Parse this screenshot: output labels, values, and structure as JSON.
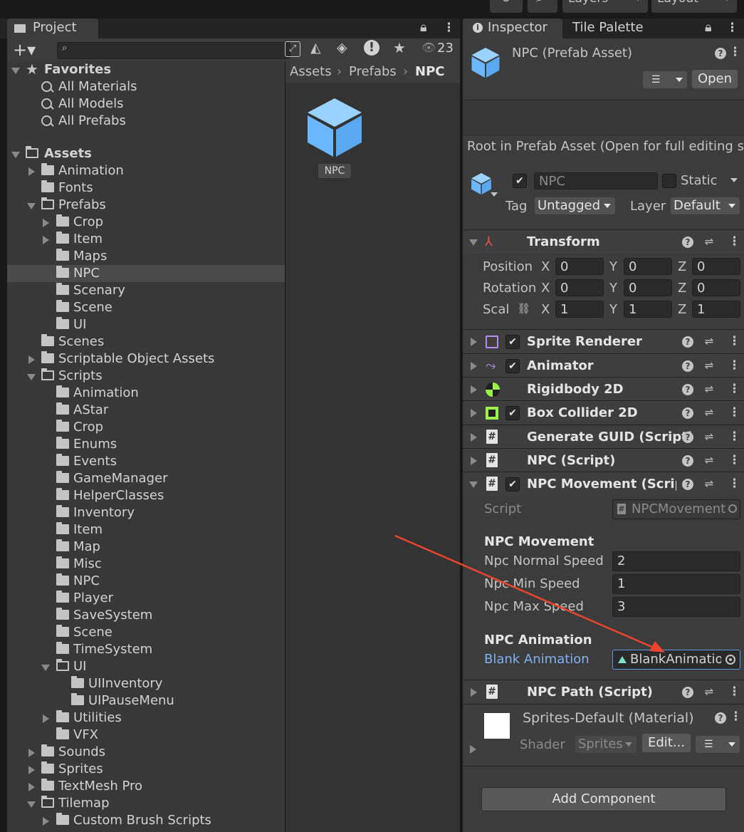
{
  "toolbar": {
    "layers_label": "Layers",
    "layout_label": "Layout"
  },
  "project": {
    "tab_label": "Project",
    "hidden_count": "23",
    "breadcrumb": [
      "Assets",
      "Prefabs",
      "NPC"
    ],
    "asset_label": "NPC",
    "favorites": {
      "label": "Favorites",
      "items": [
        "All Materials",
        "All Models",
        "All Prefabs"
      ]
    },
    "tree": [
      "Assets",
      "Animation",
      "Fonts",
      "Prefabs",
      "Crop",
      "Item",
      "Maps",
      "NPC",
      "Scenary",
      "Scene",
      "UI",
      "Scenes",
      "Scriptable Object Assets",
      "Scripts",
      "Animation",
      "AStar",
      "Crop",
      "Enums",
      "Events",
      "GameManager",
      "HelperClasses",
      "Inventory",
      "Item",
      "Map",
      "Misc",
      "NPC",
      "Player",
      "SaveSystem",
      "Scene",
      "TimeSystem",
      "UI",
      "UIInventory",
      "UIPauseMenu",
      "Utilities",
      "VFX",
      "Sounds",
      "Sprites",
      "TextMesh Pro",
      "Tilemap",
      "Custom Brush Scripts"
    ]
  },
  "inspector": {
    "tab_label": "Inspector",
    "tab2_label": "Tile Palette",
    "title": "NPC (Prefab Asset)",
    "open_label": "Open",
    "root_notice": "Root in Prefab Asset (Open for full editing su",
    "name_value": "NPC",
    "static_label": "Static",
    "tag_label": "Tag",
    "tag_value": "Untagged",
    "layer_label": "Layer",
    "layer_value": "Default",
    "transform": {
      "label": "Transform",
      "position_label": "Position",
      "rotation_label": "Rotation",
      "scale_label": "Scal",
      "position": [
        "0",
        "0",
        "0"
      ],
      "rotation": [
        "0",
        "0",
        "0"
      ],
      "scale": [
        "1",
        "1",
        "1"
      ],
      "axes": [
        "X",
        "Y",
        "Z"
      ]
    },
    "components": [
      "Sprite Renderer",
      "Animator",
      "Rigidbody 2D",
      "Box Collider 2D",
      "Generate GUID (Script)",
      "NPC (Script)",
      "NPC Movement (Script",
      "NPC Path (Script)"
    ],
    "movement": {
      "script_label": "Script",
      "script_value": "NPCMovement",
      "section1": "NPC Movement",
      "normal_label": "Npc Normal Speed",
      "normal_value": "2",
      "min_label": "Npc Min Speed",
      "min_value": "1",
      "max_label": "Npc Max Speed",
      "max_value": "3",
      "section2": "NPC Animation",
      "blank_label": "Blank Animation",
      "blank_value": "BlankAnimation"
    },
    "material": {
      "title": "Sprites-Default (Material)",
      "shader_label": "Shader",
      "shader_value": "Sprites",
      "edit_label": "Edit..."
    },
    "add_component_label": "Add Component"
  },
  "colors": {
    "accent_blue": "#6cb8ff",
    "link_blue": "#7fb2f0",
    "annotation_red": "#e8452c"
  }
}
